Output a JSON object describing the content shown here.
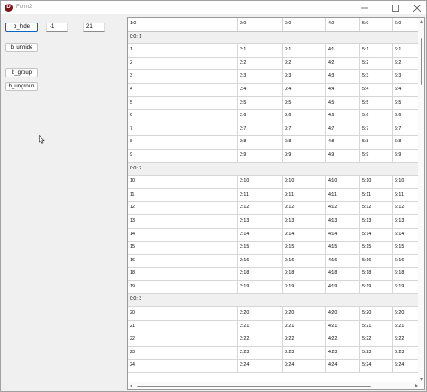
{
  "window": {
    "title": "Form2",
    "icon_letter": "D"
  },
  "controls": {
    "hide_button": "b_hide",
    "unhide_button": "b_unhide",
    "group_button": "b_group",
    "ungroup_button": "b_ungroup",
    "field_a": "-1",
    "field_b": "21"
  },
  "grid": {
    "columns": [
      "1:0",
      "2:0",
      "3:0",
      "4:0",
      "5:0",
      "6:0"
    ],
    "sections": [
      {
        "label": "0:0: 1",
        "rows": [
          [
            "1",
            "2:1",
            "3:1",
            "4:1",
            "5:1",
            "6:1"
          ],
          [
            "2",
            "2:2",
            "3:2",
            "4:2",
            "5:2",
            "6:2"
          ],
          [
            "3",
            "2:3",
            "3:3",
            "4:3",
            "5:3",
            "6:3"
          ],
          [
            "4",
            "2:4",
            "3:4",
            "4:4",
            "5:4",
            "6:4"
          ],
          [
            "5",
            "2:5",
            "3:5",
            "4:5",
            "5:5",
            "6:5"
          ],
          [
            "6",
            "2:6",
            "3:6",
            "4:6",
            "5:6",
            "6:6"
          ],
          [
            "7",
            "2:7",
            "3:7",
            "4:7",
            "5:7",
            "6:7"
          ],
          [
            "8",
            "2:8",
            "3:8",
            "4:8",
            "5:8",
            "6:8"
          ],
          [
            "9",
            "2:9",
            "3:9",
            "4:9",
            "5:9",
            "6:9"
          ]
        ]
      },
      {
        "label": "0:0: 2",
        "rows": [
          [
            "10",
            "2:10",
            "3:10",
            "4:10",
            "5:10",
            "6:10"
          ],
          [
            "11",
            "2:11",
            "3:11",
            "4:11",
            "5:11",
            "6:11"
          ],
          [
            "12",
            "2:12",
            "3:12",
            "4:12",
            "5:12",
            "6:12"
          ],
          [
            "13",
            "2:13",
            "3:13",
            "4:13",
            "5:13",
            "6:13"
          ],
          [
            "14",
            "2:14",
            "3:14",
            "4:14",
            "5:14",
            "6:14"
          ],
          [
            "15",
            "2:15",
            "3:15",
            "4:15",
            "5:15",
            "6:15"
          ],
          [
            "16",
            "2:16",
            "3:16",
            "4:16",
            "5:16",
            "6:16"
          ],
          [
            "18",
            "2:18",
            "3:18",
            "4:18",
            "5:18",
            "6:18"
          ],
          [
            "19",
            "2:19",
            "3:19",
            "4:19",
            "5:19",
            "6:19"
          ]
        ]
      },
      {
        "label": "0:0: 3",
        "rows": [
          [
            "20",
            "2:20",
            "3:20",
            "4:20",
            "5:20",
            "6:20"
          ],
          [
            "21",
            "2:21",
            "3:21",
            "4:21",
            "5:21",
            "6:21"
          ],
          [
            "22",
            "2:22",
            "3:22",
            "4:22",
            "5:22",
            "6:22"
          ],
          [
            "23",
            "2:23",
            "3:23",
            "4:23",
            "5:23",
            "6:23"
          ],
          [
            "24",
            "2:24",
            "3:24",
            "4:24",
            "5:24",
            "6:24"
          ]
        ]
      }
    ]
  }
}
